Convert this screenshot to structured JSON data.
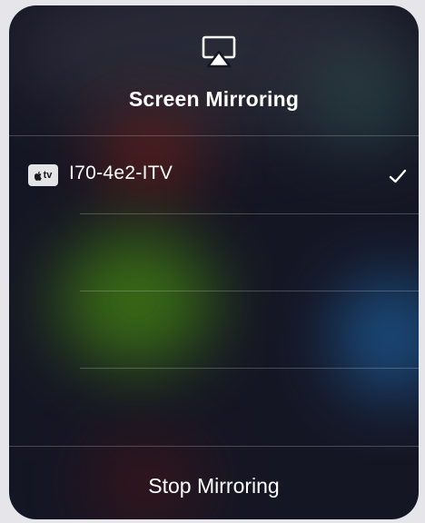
{
  "mirroring": {
    "title": "Screen Mirroring",
    "devices": [
      {
        "badge": "tv",
        "name": "I70-4e2-ITV",
        "selected": true
      }
    ],
    "stop_label": "Stop Mirroring"
  },
  "icons": {
    "header": "airplay-icon",
    "device_badge": "apple-tv-icon",
    "selected": "checkmark-icon"
  }
}
